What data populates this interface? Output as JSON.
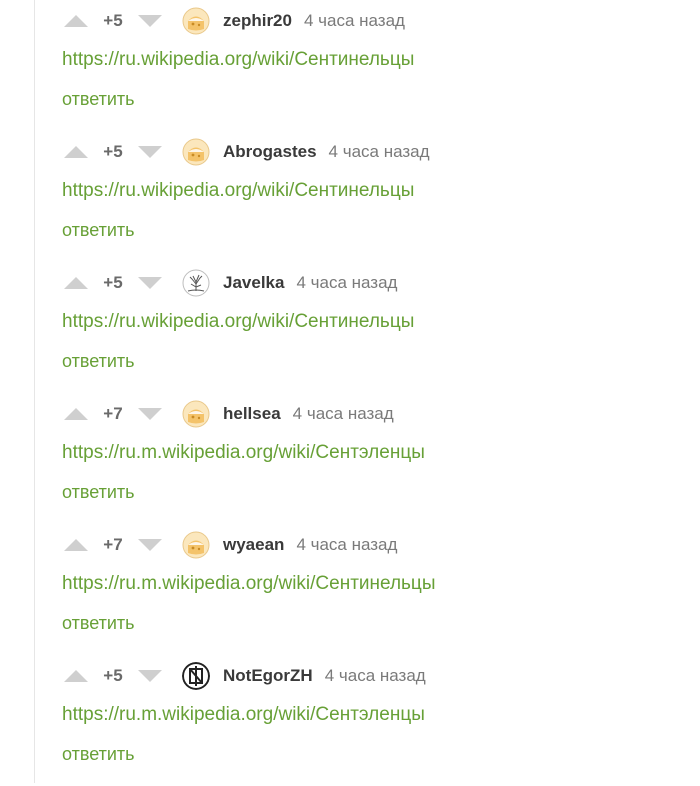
{
  "colors": {
    "link": "#67a036",
    "vote_arrow": "#cfcfcf",
    "rating": "#6a6a6a",
    "username": "#3a3a3a",
    "time": "#7a7a7a"
  },
  "reply_label": "ответить",
  "comments": [
    {
      "rating": "+5",
      "username": "zephir20",
      "time": "4 часа назад",
      "link": "https://ru.wikipedia.org/wiki/Сентинельцы",
      "reply": "ответить",
      "avatar_icon": "default-avatar-icon"
    },
    {
      "rating": "+5",
      "username": "Abrogastes",
      "time": "4 часа назад",
      "link": "https://ru.wikipedia.org/wiki/Сентинельцы",
      "reply": "ответить",
      "avatar_icon": "default-avatar-icon"
    },
    {
      "rating": "+5",
      "username": "Javelka",
      "time": "4 часа назад",
      "link": "https://ru.wikipedia.org/wiki/Сентинельцы",
      "reply": "ответить",
      "avatar_icon": "tree-avatar-icon"
    },
    {
      "rating": "+7",
      "username": "hellsea",
      "time": "4 часа назад",
      "link": "https://ru.m.wikipedia.org/wiki/Сентэленцы",
      "reply": "ответить",
      "avatar_icon": "default-avatar-icon"
    },
    {
      "rating": "+7",
      "username": "wyaean",
      "time": "4 часа назад",
      "link": "https://ru.m.wikipedia.org/wiki/Сентинельцы",
      "reply": "ответить",
      "avatar_icon": "default-avatar-icon"
    },
    {
      "rating": "+5",
      "username": "NotEgorZH",
      "time": "4 часа назад",
      "link": "https://ru.m.wikipedia.org/wiki/Сентэленцы",
      "reply": "ответить",
      "avatar_icon": "rammstein-avatar-icon"
    }
  ]
}
